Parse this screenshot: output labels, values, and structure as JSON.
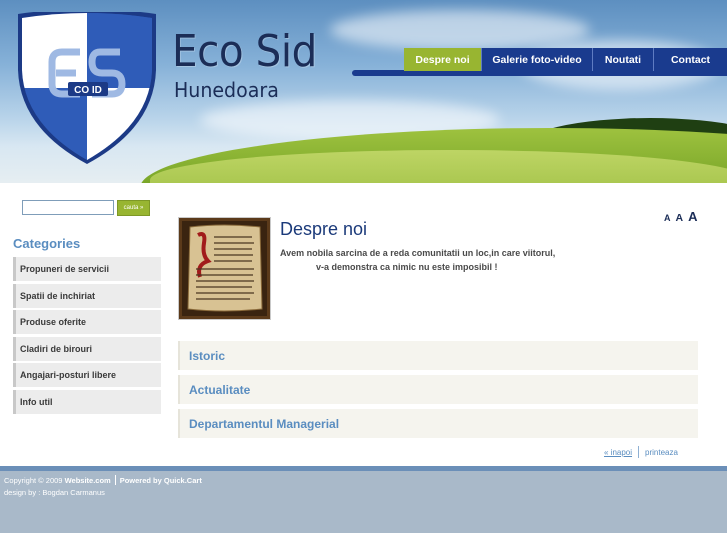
{
  "brand": {
    "title": "Eco Sid",
    "subtitle": "Hunedoara",
    "logo_text": "ES",
    "logo_sub": "CO ID"
  },
  "nav": {
    "items": [
      "Despre noi",
      "Galerie foto-video",
      "Noutati",
      "Contact"
    ],
    "active": "Despre noi"
  },
  "search": {
    "placeholder": "",
    "button_label": "cauta »"
  },
  "sidebar": {
    "title": "Categories",
    "items": [
      "Propuneri de servicii",
      "Spatii de inchiriat",
      "Produse oferite",
      "Cladiri de birouri",
      "Angajari-posturi libere",
      "Info util"
    ]
  },
  "main": {
    "title": "Despre noi",
    "intro_line1": "Avem nobila sarcina de a reda comunitatii un loc,in care viitorul,",
    "intro_line2": "v-a demonstra ca nimic nu este imposibil !",
    "font_sizes": [
      "A",
      "A",
      "A"
    ],
    "sections": [
      "Istoric",
      "Actualitate",
      "Departamentul Managerial"
    ],
    "back_link": "« inapoi",
    "print_link": "printeaza"
  },
  "footer": {
    "copyright": "Copyright © 2009",
    "website": "Website.com",
    "powered": "Powered by Quick.Cart",
    "design": "design by : Bogdan Carmanus"
  },
  "colors": {
    "navy": "#1a3b8e",
    "accent_green": "#98b531",
    "link_blue": "#5a8dc0",
    "footer": "#a9b9c9"
  }
}
